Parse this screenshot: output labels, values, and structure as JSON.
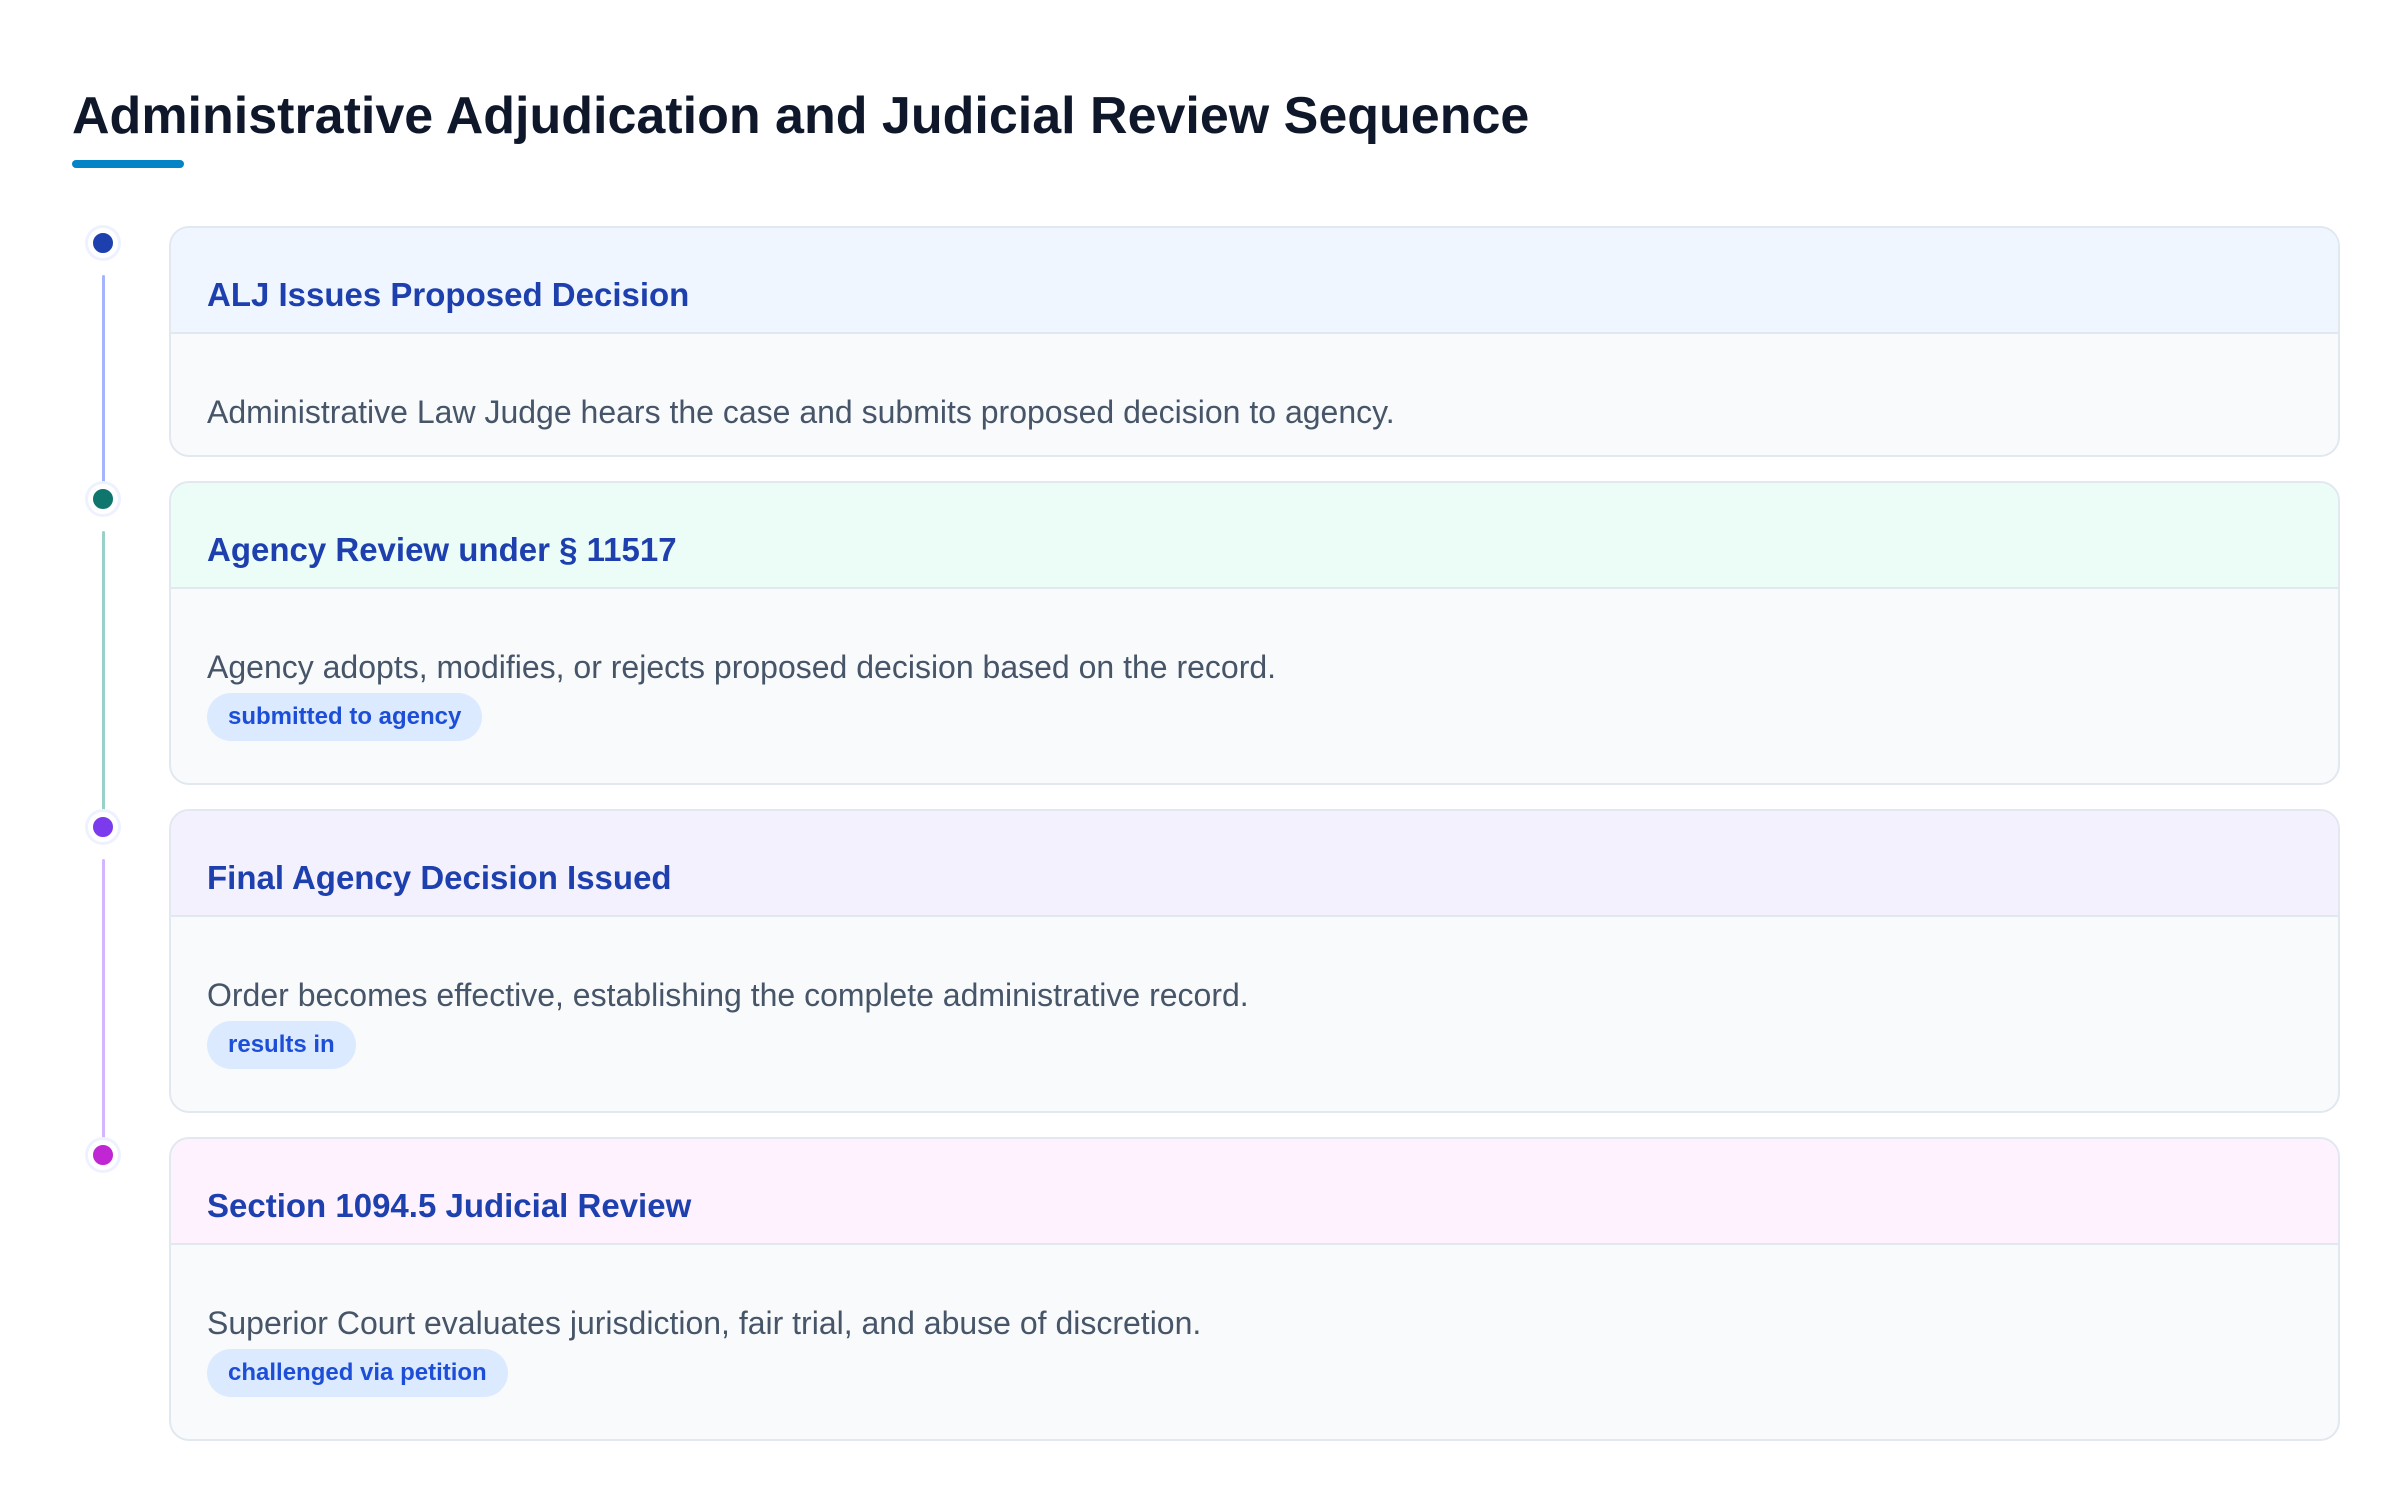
{
  "page": {
    "title": "Administrative Adjudication and Judicial Review Sequence",
    "accent_color": "#0284c7"
  },
  "steps": [
    {
      "title": "ALJ Issues Proposed Decision",
      "description": "Administrative Law Judge hears the case and submits proposed decision to agency.",
      "badge": "",
      "dot_color": "#1e40af",
      "line_color": "#a5b4fc",
      "header_color": "#eff6ff"
    },
    {
      "title": "Agency Review under § 11517",
      "description": "Agency adopts, modifies, or rejects proposed decision based on the record.",
      "badge": "submitted to agency",
      "dot_color": "#0f766e",
      "line_color": "#99d0c8",
      "header_color": "#ecfdf8"
    },
    {
      "title": "Final Agency Decision Issued",
      "description": "Order becomes effective, establishing the complete administrative record.",
      "badge": "results in",
      "dot_color": "#7c3aed",
      "line_color": "#d3b6fb",
      "header_color": "#f3f1fe"
    },
    {
      "title": "Section 1094.5 Judicial Review",
      "description": "Superior Court evaluates jurisdiction, fair trial, and abuse of discretion.",
      "badge": "challenged via petition",
      "dot_color": "#c026d3",
      "line_color": "#f0abfc",
      "header_color": "#fdf2fd"
    }
  ]
}
